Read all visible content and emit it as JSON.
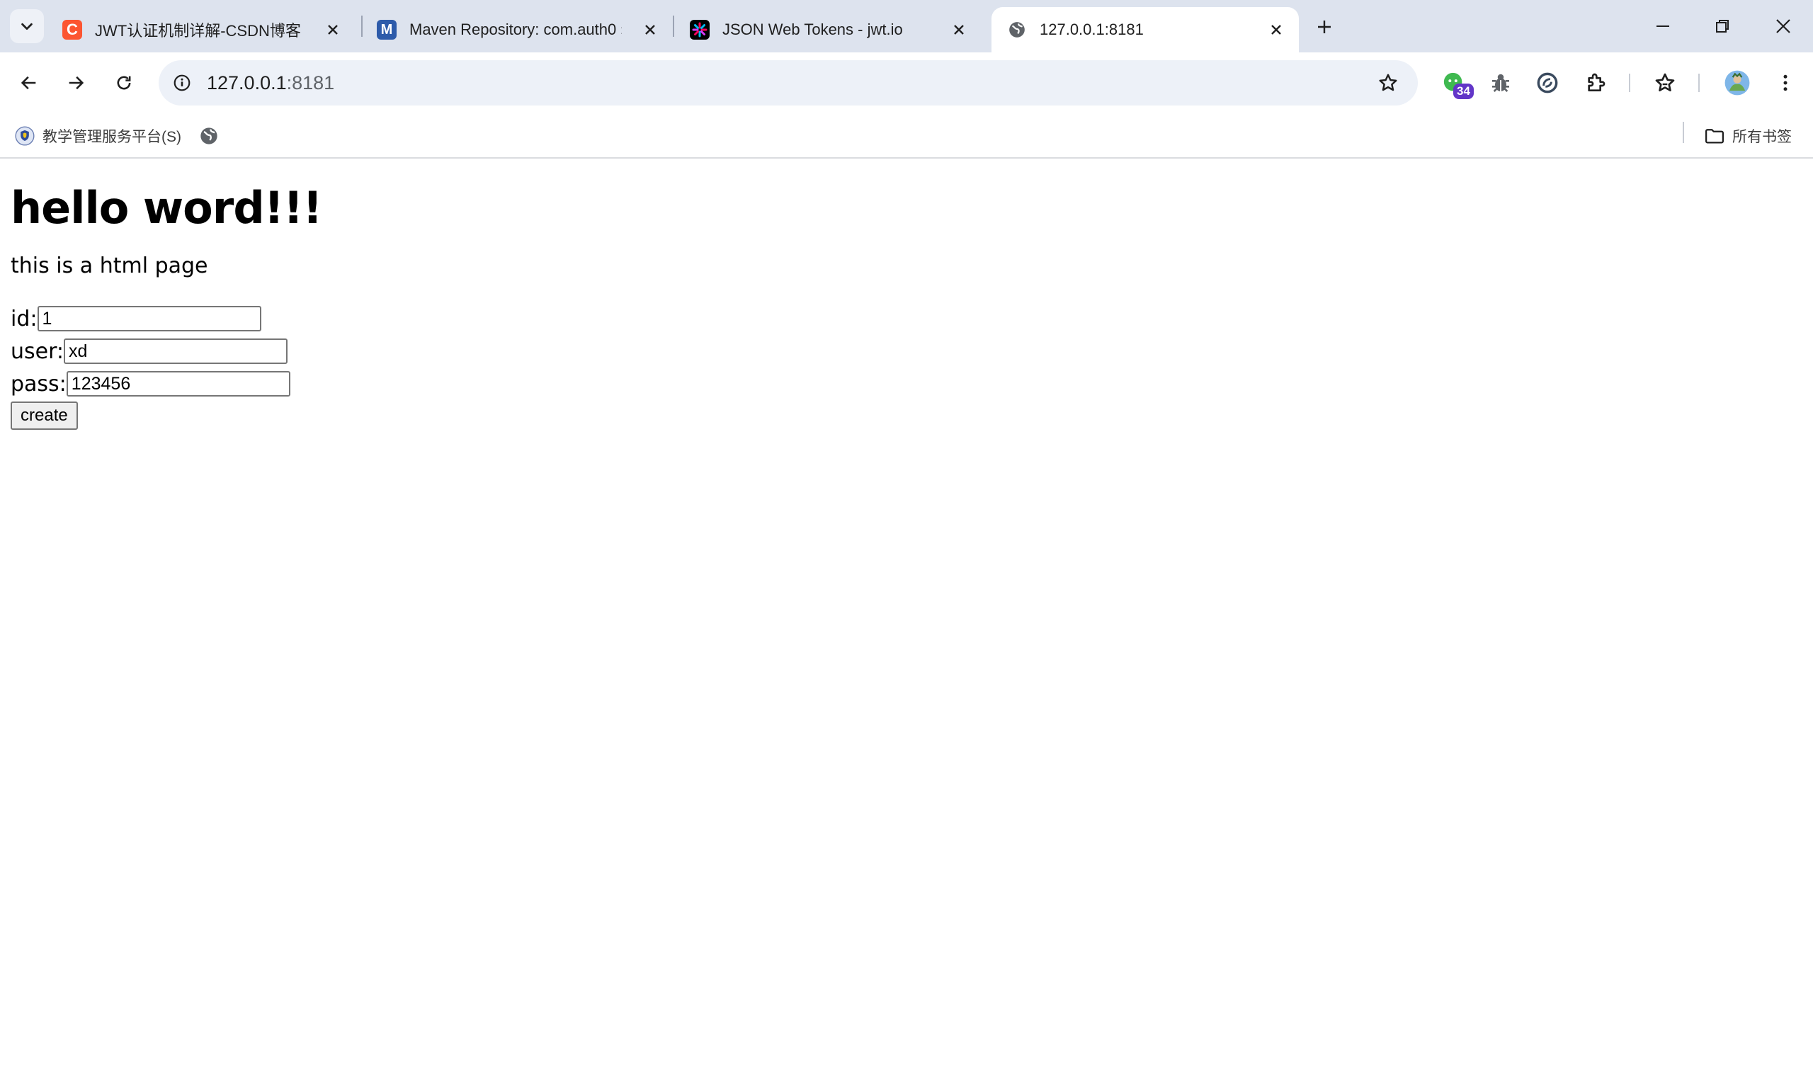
{
  "browser": {
    "tabs": [
      {
        "title": "JWT认证机制详解-CSDN博客",
        "favicon": "csdn-icon",
        "favicon_color": "#fc5531",
        "active": false
      },
      {
        "title": "Maven Repository: com.auth0 »",
        "favicon": "maven-icon",
        "favicon_color": "#2d5baa",
        "active": false
      },
      {
        "title": "JSON Web Tokens - jwt.io",
        "favicon": "jwt-icon",
        "favicon_color": "#000000",
        "active": false
      },
      {
        "title": "127.0.0.1:8181",
        "favicon": "globe-icon",
        "favicon_color": "#5f6368",
        "active": true
      }
    ],
    "address": {
      "url_host": "127.0.0.1",
      "url_port": ":8181"
    },
    "extensions": {
      "badge_count": "34"
    },
    "bookmarks": {
      "items": [
        {
          "label": "教学管理服务平台(S)",
          "icon": "shield-icon"
        },
        {
          "label": "",
          "icon": "globe-icon"
        }
      ],
      "all_bookmarks_label": "所有书签"
    },
    "colors": {
      "tabstrip": "#dde3ee",
      "omnibox": "#edf1f8",
      "badge": "#6236c8"
    }
  },
  "page": {
    "heading": "hello word!!!",
    "subtitle": "this is a html page",
    "form": {
      "id_label": "id:",
      "id_value": "1",
      "user_label": "user:",
      "user_value": "xd",
      "pass_label": "pass:",
      "pass_value": "123456",
      "submit_label": "create"
    }
  }
}
